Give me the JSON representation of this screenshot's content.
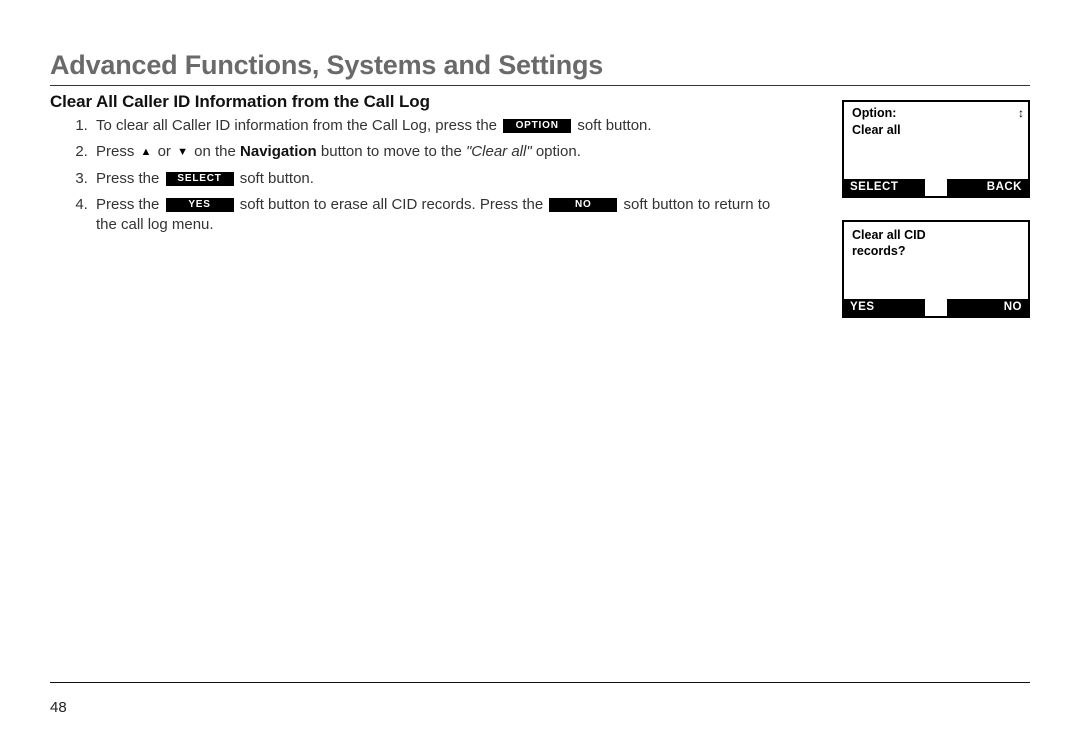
{
  "header": {
    "title": "Advanced Functions, Systems and Settings"
  },
  "section": {
    "subheading": "Clear All Caller ID Information from the Call Log"
  },
  "steps": {
    "s1_pre": "To clear all Caller ID information from the Call Log, press the ",
    "s1_chip": "OPTION",
    "s1_post": " soft button.",
    "s2_pre": "Press ",
    "s2_or": "  or  ",
    "s2_mid": " on the ",
    "s2_nav": "Navigation",
    "s2_mid2": " button to move to the ",
    "s2_opt": "\"Clear all\"",
    "s2_post": " option.",
    "s3_pre": "Press the ",
    "s3_chip": "SELECT",
    "s3_post": " soft button.",
    "s4_pre": "Press the ",
    "s4_chip1": "YES",
    "s4_mid": " soft button to erase all CID records. Press the ",
    "s4_chip2": "NO",
    "s4_post": " soft button to return to the call log menu."
  },
  "icons": {
    "up": "▲",
    "down": "▼",
    "updown": "↕"
  },
  "screens": {
    "a": {
      "title": "Option:",
      "line1": "Clear all",
      "sk_left": "SELECT",
      "sk_right": "BACK"
    },
    "b": {
      "line1": "Clear all CID",
      "line2": "records?",
      "sk_left": "YES",
      "sk_right": "NO"
    }
  },
  "page_number": "48"
}
